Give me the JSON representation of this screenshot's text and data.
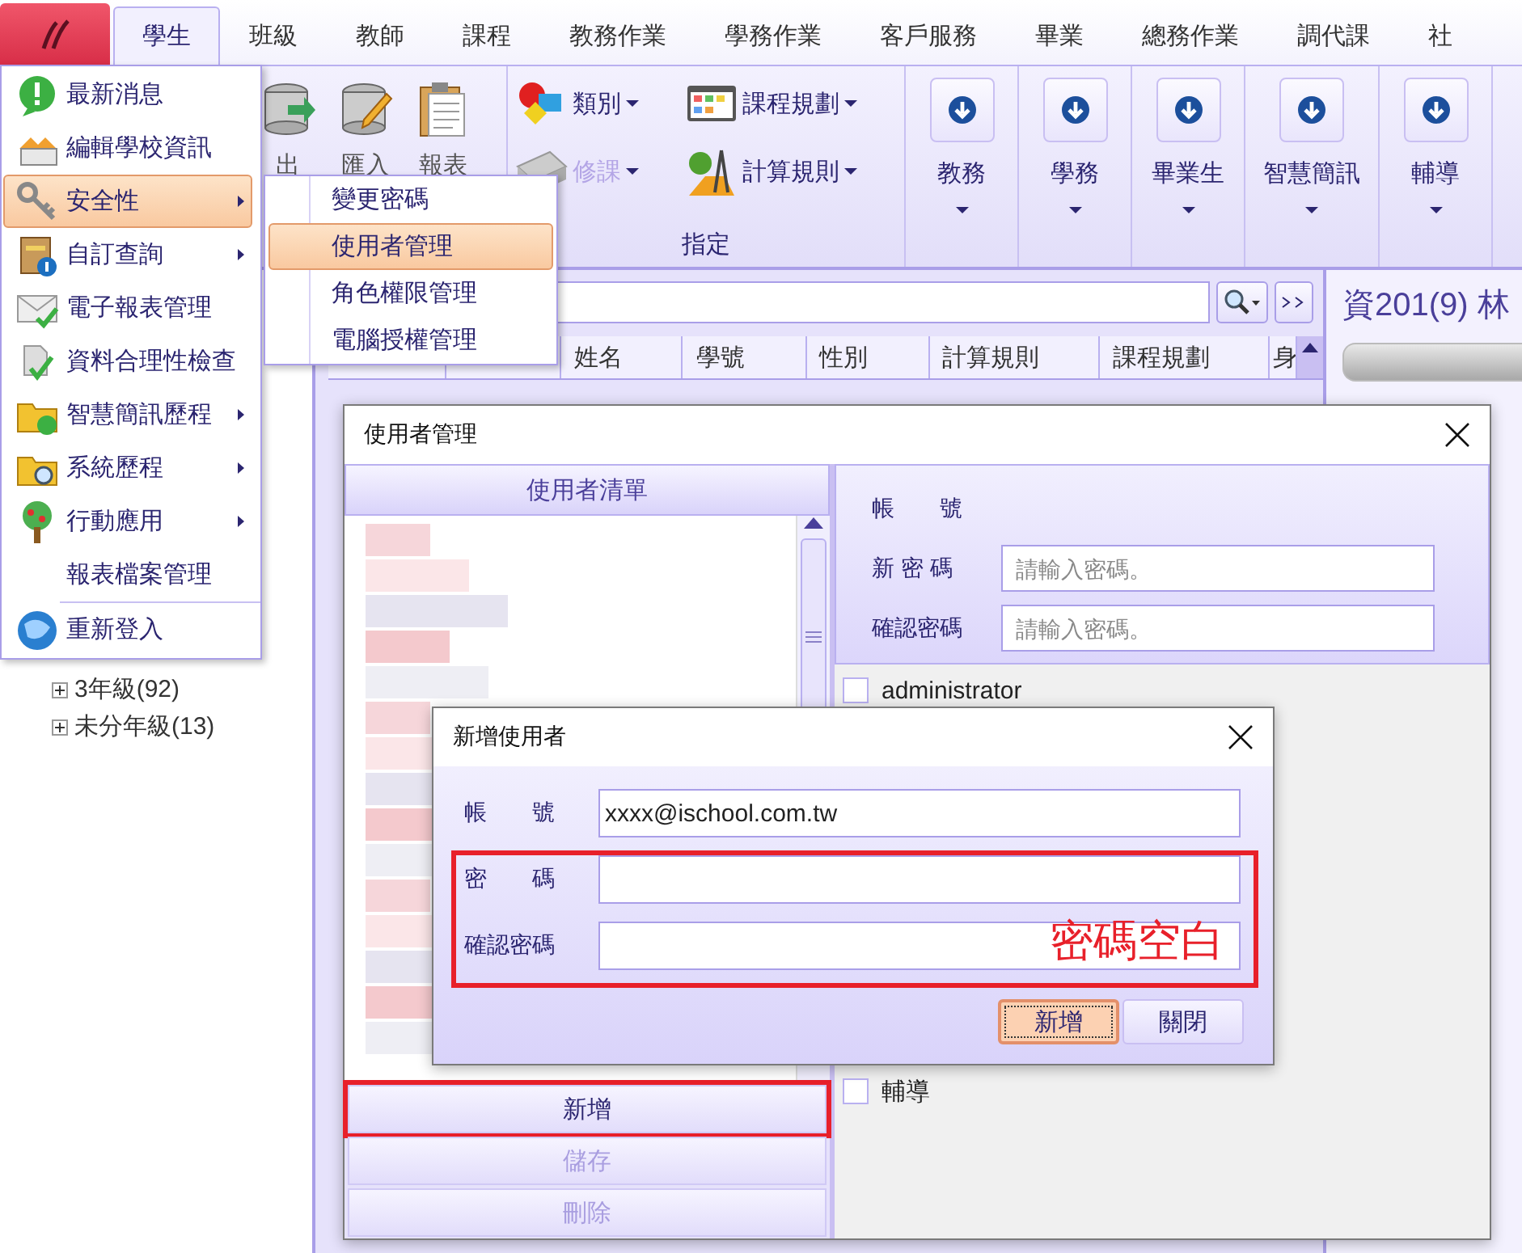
{
  "tabs": [
    {
      "label": "學生",
      "selected": true
    },
    {
      "label": "班級",
      "selected": false
    },
    {
      "label": "教師",
      "selected": false
    },
    {
      "label": "課程",
      "selected": false
    },
    {
      "label": "教務作業",
      "selected": false
    },
    {
      "label": "學務作業",
      "selected": false
    },
    {
      "label": "客戶服務",
      "selected": false
    },
    {
      "label": "畢業",
      "selected": false
    },
    {
      "label": "總務作業",
      "selected": false
    },
    {
      "label": "調代課",
      "selected": false
    },
    {
      "label": "社",
      "selected": false
    }
  ],
  "ribbon": {
    "file_buttons": [
      {
        "label": "出"
      },
      {
        "label": "匯入"
      },
      {
        "label": "報表"
      }
    ],
    "assign_group": {
      "title": "指定",
      "items": [
        {
          "label": "類別",
          "disabled": false
        },
        {
          "label": "課程規劃",
          "disabled": false
        },
        {
          "label": "修課",
          "disabled": true
        },
        {
          "label": "計算規則",
          "disabled": false
        }
      ]
    },
    "big_buttons": [
      {
        "label": "教務"
      },
      {
        "label": "學務"
      },
      {
        "label": "畢業生"
      },
      {
        "label": "智慧簡訊"
      },
      {
        "label": "輔導"
      }
    ]
  },
  "tree": [
    {
      "label": "3年級(92)",
      "expanded": false
    },
    {
      "label": "未分年級(13)",
      "expanded": false
    }
  ],
  "table": {
    "columns": [
      "姓名",
      "學號",
      "性別",
      "計算規則",
      "課程規劃",
      "身"
    ]
  },
  "detail": {
    "title": "資201(9) 林"
  },
  "menu": {
    "items": [
      {
        "label": "最新消息",
        "has_submenu": false,
        "selected": false
      },
      {
        "label": "編輯學校資訊",
        "has_submenu": false,
        "selected": false
      },
      {
        "label": "安全性",
        "has_submenu": true,
        "selected": true
      },
      {
        "label": "自訂查詢",
        "has_submenu": true,
        "selected": false
      },
      {
        "label": "電子報表管理",
        "has_submenu": false,
        "selected": false
      },
      {
        "label": "資料合理性檢查",
        "has_submenu": false,
        "selected": false
      },
      {
        "label": "智慧簡訊歷程",
        "has_submenu": true,
        "selected": false
      },
      {
        "label": "系統歷程",
        "has_submenu": true,
        "selected": false
      },
      {
        "label": "行動應用",
        "has_submenu": true,
        "selected": false
      },
      {
        "label": "報表檔案管理",
        "has_submenu": false,
        "selected": false
      },
      {
        "label": "重新登入",
        "has_submenu": false,
        "selected": false
      }
    ]
  },
  "submenu": {
    "items": [
      {
        "label": "變更密碼",
        "selected": false
      },
      {
        "label": "使用者管理",
        "selected": true
      },
      {
        "label": "角色權限管理",
        "selected": false
      },
      {
        "label": "電腦授權管理",
        "selected": false
      }
    ]
  },
  "user_dialog": {
    "title": "使用者管理",
    "list_header": "使用者清單",
    "buttons": [
      {
        "label": "新增",
        "disabled": false,
        "highlighted": true
      },
      {
        "label": "儲存",
        "disabled": true,
        "highlighted": false
      },
      {
        "label": "刪除",
        "disabled": true,
        "highlighted": false
      }
    ],
    "account_label": "帳　　號",
    "fields": [
      {
        "label": "新 密 碼",
        "placeholder": "請輸入密碼。"
      },
      {
        "label": "確認密碼",
        "placeholder": "請輸入密碼。"
      }
    ],
    "roles": [
      {
        "label": "administrator",
        "checked": false
      },
      {
        "label": "輔導",
        "checked": false
      }
    ]
  },
  "add_dialog": {
    "title": "新增使用者",
    "fields": [
      {
        "label": "帳　　號",
        "value": "xxxx@ischool.com.tw"
      },
      {
        "label": "密　　碼"
      },
      {
        "label": "確認密碼"
      }
    ],
    "annotation": "密碼空白",
    "buttons": [
      {
        "label": "新增",
        "focused": true
      },
      {
        "label": "關閉",
        "focused": false
      }
    ]
  }
}
